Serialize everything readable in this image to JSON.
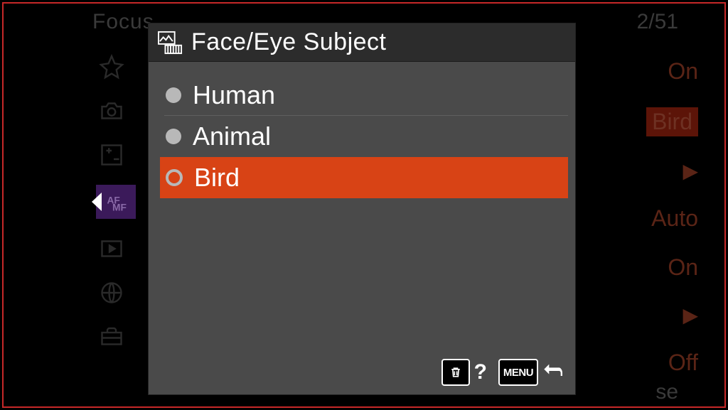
{
  "background": {
    "header": "Focus",
    "page": "2/51",
    "close": "se",
    "values": [
      "On",
      "Bird",
      "▶",
      "Auto",
      "On",
      "▶",
      "Off"
    ]
  },
  "modal": {
    "title": "Face/Eye Subject",
    "options": [
      {
        "label": "Human",
        "selected": false
      },
      {
        "label": "Animal",
        "selected": false
      },
      {
        "label": "Bird",
        "selected": true
      }
    ],
    "footer": {
      "help": "?",
      "menu": "MENU"
    }
  }
}
